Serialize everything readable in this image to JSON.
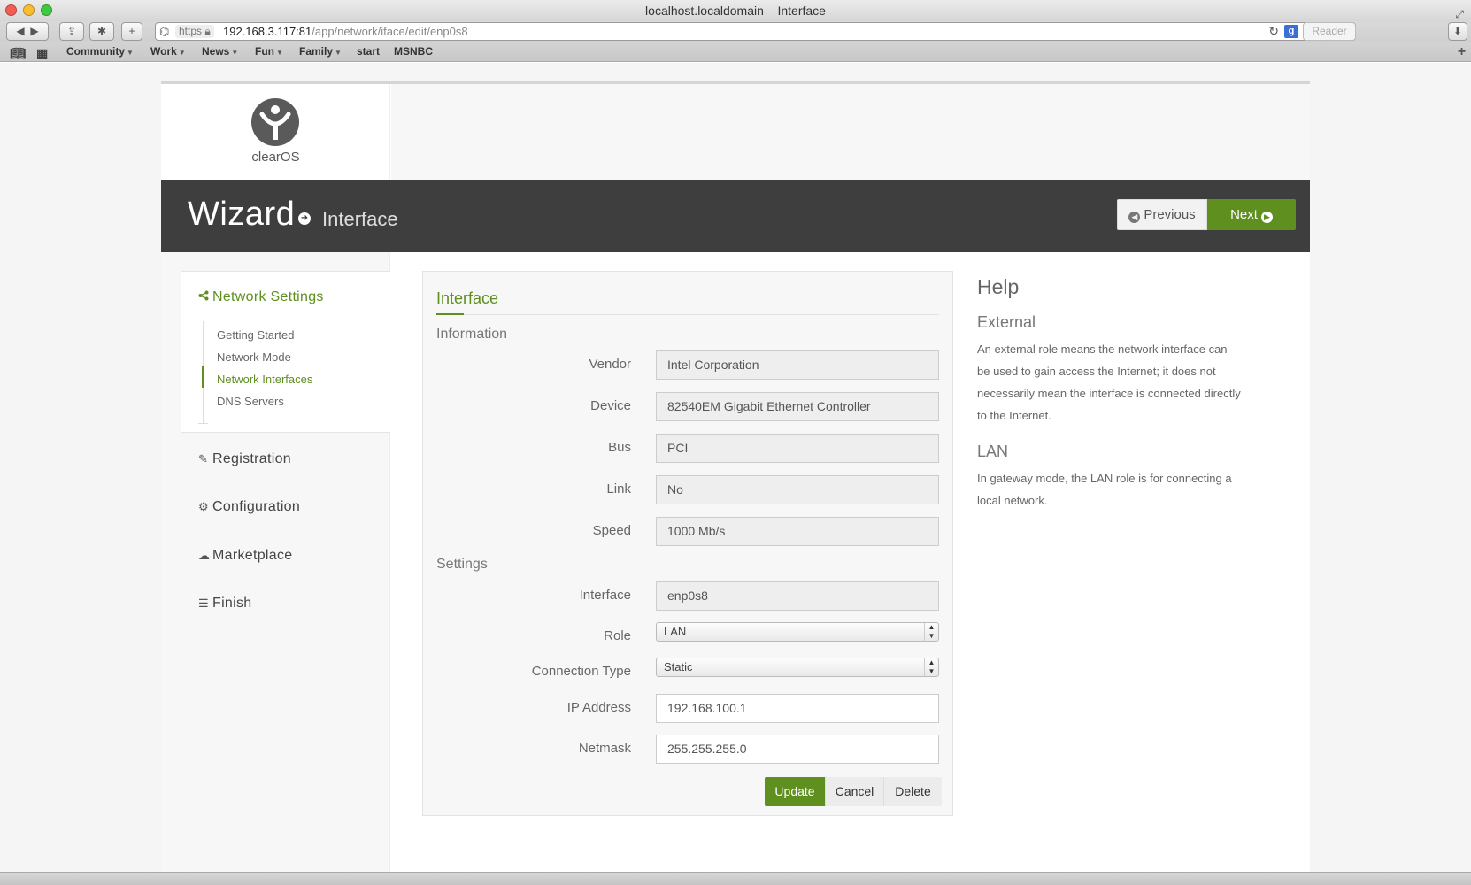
{
  "window": {
    "title": "localhost.localdomain – Interface"
  },
  "browser": {
    "url_scheme": "https",
    "url_host": "192.168.3.117:81",
    "url_path": "/app/network/iface/edit/enp0s8",
    "reader_label": "Reader",
    "bookmarks": [
      {
        "label": "Community",
        "has_menu": true
      },
      {
        "label": "Work",
        "has_menu": true
      },
      {
        "label": "News",
        "has_menu": true
      },
      {
        "label": "Fun",
        "has_menu": true
      },
      {
        "label": "Family",
        "has_menu": true
      },
      {
        "label": "start",
        "has_menu": false
      },
      {
        "label": "MSNBC",
        "has_menu": false
      }
    ]
  },
  "logo": {
    "text": "clearOS"
  },
  "banner": {
    "title": "Wizard",
    "crumb": "Interface",
    "prev_label": "Previous",
    "next_label": "Next"
  },
  "sidebar": {
    "active_group": {
      "label": "Network Settings",
      "items": [
        {
          "label": "Getting Started",
          "active": false
        },
        {
          "label": "Network Mode",
          "active": false
        },
        {
          "label": "Network Interfaces",
          "active": true
        },
        {
          "label": "DNS Servers",
          "active": false
        }
      ]
    },
    "groups": [
      {
        "label": "Registration",
        "icon": "pencil-icon"
      },
      {
        "label": "Configuration",
        "icon": "cogs-icon"
      },
      {
        "label": "Marketplace",
        "icon": "cloud-download-icon"
      },
      {
        "label": "Finish",
        "icon": "tasks-icon"
      }
    ]
  },
  "form": {
    "title": "Interface",
    "section_info": "Information",
    "section_settings": "Settings",
    "vendor": {
      "label": "Vendor",
      "value": "Intel Corporation"
    },
    "device": {
      "label": "Device",
      "value": "82540EM Gigabit Ethernet Controller"
    },
    "bus": {
      "label": "Bus",
      "value": "PCI"
    },
    "link": {
      "label": "Link",
      "value": "No"
    },
    "speed": {
      "label": "Speed",
      "value": "1000 Mb/s"
    },
    "interface": {
      "label": "Interface",
      "value": "enp0s8"
    },
    "role": {
      "label": "Role",
      "value": "LAN"
    },
    "conn_type": {
      "label": "Connection Type",
      "value": "Static"
    },
    "ip": {
      "label": "IP Address",
      "value": "192.168.100.1"
    },
    "netmask": {
      "label": "Netmask",
      "value": "255.255.255.0"
    },
    "update_label": "Update",
    "cancel_label": "Cancel",
    "delete_label": "Delete"
  },
  "help": {
    "title": "Help",
    "external_heading": "External",
    "external_text": "An external role means the network interface can be used to gain access the Internet; it does not necessarily mean the interface is connected directly to the Internet.",
    "lan_heading": "LAN",
    "lan_text": "In gateway mode, the LAN role is for connecting a local network."
  },
  "colors": {
    "accent": "#5e8f1f",
    "banner": "#3e3e3e"
  }
}
